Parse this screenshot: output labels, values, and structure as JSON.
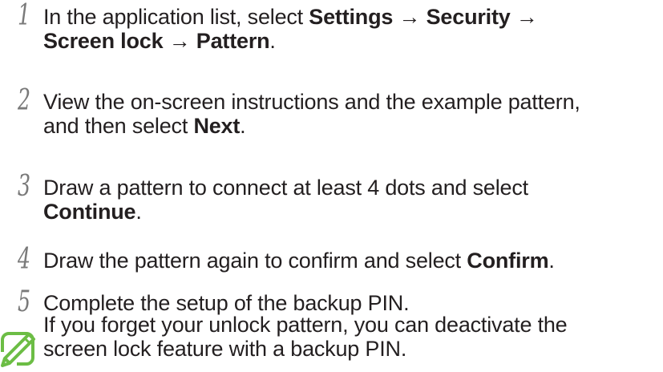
{
  "steps": [
    {
      "number": "1",
      "line1": {
        "t1": "In the application list, select ",
        "b1": "Settings",
        "t2": " → ",
        "b2": "Security",
        "t3": " →"
      },
      "line2": {
        "b1": "Screen lock",
        "t1": " → ",
        "b2": "Pattern",
        "t2": "."
      }
    },
    {
      "number": "2",
      "line1": "View the on-screen instructions and the example pattern,",
      "line2": {
        "t1": "and then select ",
        "b1": "Next",
        "t2": "."
      }
    },
    {
      "number": "3",
      "line1": "Draw a pattern to connect at least 4 dots and select",
      "line2": {
        "b1": "Continue",
        "t1": "."
      }
    },
    {
      "number": "4",
      "line1": {
        "t1": "Draw the pattern again to confirm and select ",
        "b1": "Confirm",
        "t2": "."
      }
    },
    {
      "number": "5",
      "line1": "Complete the setup of the backup PIN."
    }
  ],
  "note": {
    "icon": "note-pencil-icon",
    "line1": "If you forget your unlock pattern, you can deactivate the",
    "line2": "screen lock feature with a backup PIN."
  },
  "colors": {
    "text": "#231f20",
    "step_number": "#7a7a7a",
    "note_icon": "#6cbd45"
  }
}
